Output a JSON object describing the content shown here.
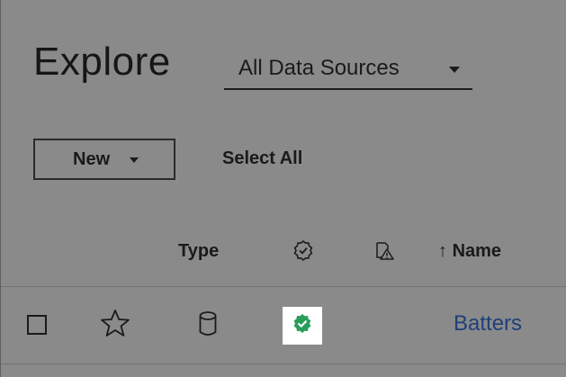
{
  "page": {
    "title": "Explore"
  },
  "filter": {
    "selected": "All Data Sources"
  },
  "toolbar": {
    "new_label": "New",
    "select_all_label": "Select All"
  },
  "columns": {
    "type_label": "Type",
    "name_label": "Name",
    "sort_arrow": "↑"
  },
  "rows": [
    {
      "name": "Batters",
      "type_icon": "database-icon",
      "certified": true,
      "favorite": false,
      "selected": false
    }
  ],
  "colors": {
    "link": "#1f3f7a",
    "certified_green": "#2a9d5a"
  }
}
